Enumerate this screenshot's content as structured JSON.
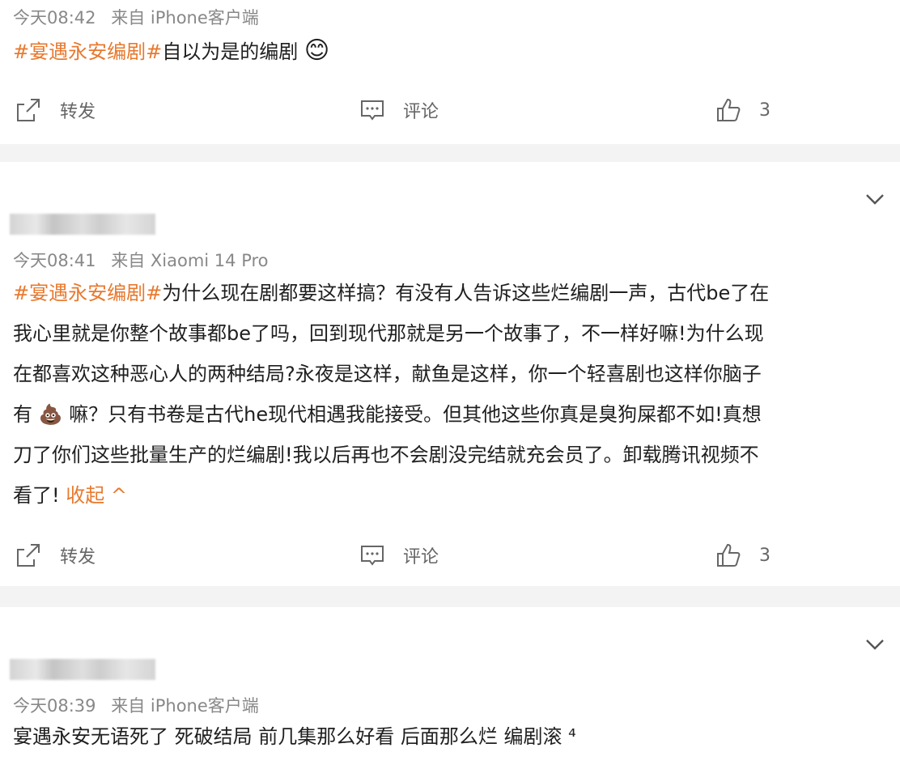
{
  "post1": {
    "meta_time": "今天08:42",
    "meta_source": "来自 iPhone客户端",
    "tag": "#宴遇永安编剧#",
    "text": "自以为是的编剧",
    "emoji": "😊",
    "actions": {
      "repost": "转发",
      "comment": "评论",
      "like_count": "3"
    }
  },
  "post2": {
    "meta_time": "今天08:41",
    "meta_source": "来自 Xiaomi 14 Pro",
    "tag": "#宴遇永安编剧#",
    "line1": "为什么现在剧都要这样搞？有没有人告诉这些烂编剧一声，古代be了在",
    "line2": "我心里就是你整个故事都be了吗，回到现代那就是另一个故事了，不一样好嘛!为什么现",
    "line3": "在都喜欢这种恶心人的两种结局?永夜是这样，献鱼是这样，你一个轻喜剧也这样你脑子",
    "line4_a": "有",
    "line4_emoji": "💩",
    "line4_b": "嘛？只有书卷是古代he现代相遇我能接受。但其他这些你真是臭狗屎都不如!真想",
    "line5": "刀了你们这些批量生产的烂编剧!我以后再也不会剧没完结就充会员了。卸载腾讯视频不",
    "line6": "看了!",
    "collapse": "收起 ^",
    "actions": {
      "repost": "转发",
      "comment": "评论",
      "like_count": "3"
    }
  },
  "post3": {
    "meta_time": "今天08:39",
    "meta_source": "来自 iPhone客户端",
    "text": "宴遇永安无语死了 死破结局 前几集那么好看 后面那么烂 编剧滚 ⁴"
  },
  "icons": [
    "repost-icon",
    "comment-icon",
    "like-icon",
    "chevron-down-icon"
  ]
}
